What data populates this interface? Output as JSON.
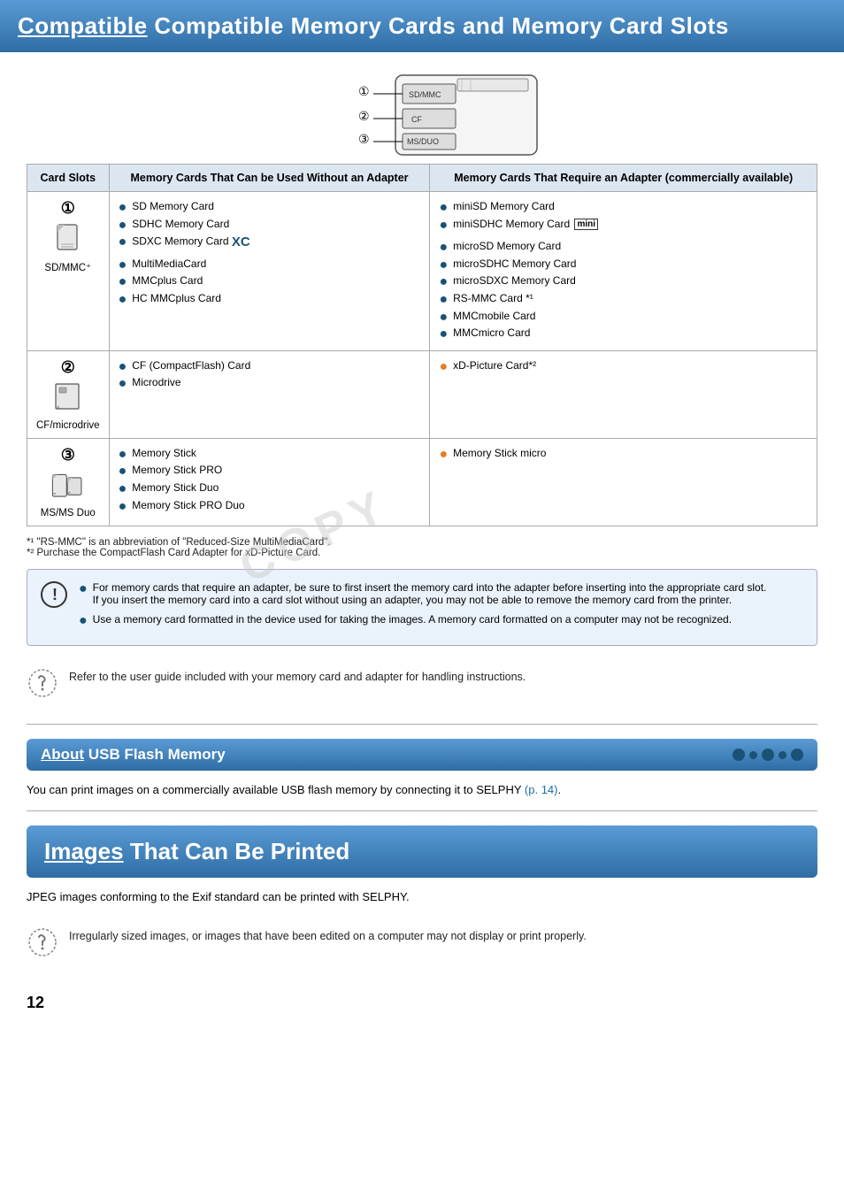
{
  "header": {
    "title": "Compatible Memory Cards and Memory Card Slots",
    "title_underline": "Compatible"
  },
  "table": {
    "col1_header": "Card Slots",
    "col2_header": "Memory Cards That Can be Used Without an Adapter",
    "col3_header": "Memory Cards That Require an Adapter (commercially available)",
    "rows": [
      {
        "slot_number": "①",
        "slot_label": "SD/MMC⁺",
        "without_adapter": [
          "SD Memory Card",
          "SDHC Memory Card",
          "SDXC Memory Card",
          "MultiMediaCard",
          "MMCplus Card",
          "HC MMCplus Card"
        ],
        "with_adapter": [
          "miniSD Memory Card",
          "miniSDHC Memory Card",
          "microSD Memory Card",
          "microSDHC Memory Card",
          "microSDXC Memory Card",
          "RS-MMC Card *¹",
          "MMCmobile Card",
          "MMCmicro Card"
        ]
      },
      {
        "slot_number": "②",
        "slot_label": "CF/microdrive",
        "without_adapter": [
          "CF (CompactFlash) Card",
          "Microdrive"
        ],
        "with_adapter": [
          "xD-Picture Card*²"
        ]
      },
      {
        "slot_number": "③",
        "slot_label": "MS/MS Duo",
        "without_adapter": [
          "Memory Stick",
          "Memory Stick PRO",
          "Memory Stick Duo",
          "Memory Stick PRO Duo"
        ],
        "with_adapter": [
          "Memory Stick micro"
        ]
      }
    ]
  },
  "footnotes": [
    "*¹ \"RS-MMC\" is an abbreviation of \"Reduced-Size MultiMediaCard\".",
    "*² Purchase the CompactFlash Card Adapter for xD-Picture Card."
  ],
  "warning": {
    "bullets": [
      "For memory cards that require an adapter, be sure to first insert the memory card into the adapter before inserting into the appropriate card slot. If you insert the memory card into a card slot without using an adapter, you may not be able to remove the memory card from the printer.",
      "Use a memory card formatted in the device used for taking the images. A memory card formatted on a computer may not be recognized."
    ]
  },
  "note": {
    "text": "Refer to the user guide included with your memory card and adapter for handling instructions."
  },
  "usb_section": {
    "title": "About USB Flash Memory",
    "title_underline": "About",
    "text": "You can print images on a commercially available USB flash memory by connecting it to SELPHY",
    "link_text": "(p. 14)",
    "dots": [
      "large",
      "small",
      "large",
      "small",
      "large"
    ]
  },
  "images_section": {
    "title": "Images That Can Be Printed",
    "title_underline": "Images",
    "text": "JPEG images conforming to the Exif standard can be printed with SELPHY.",
    "note": "Irregularly sized images, or images that have been edited on a computer may not display or print properly."
  },
  "page_number": "12"
}
